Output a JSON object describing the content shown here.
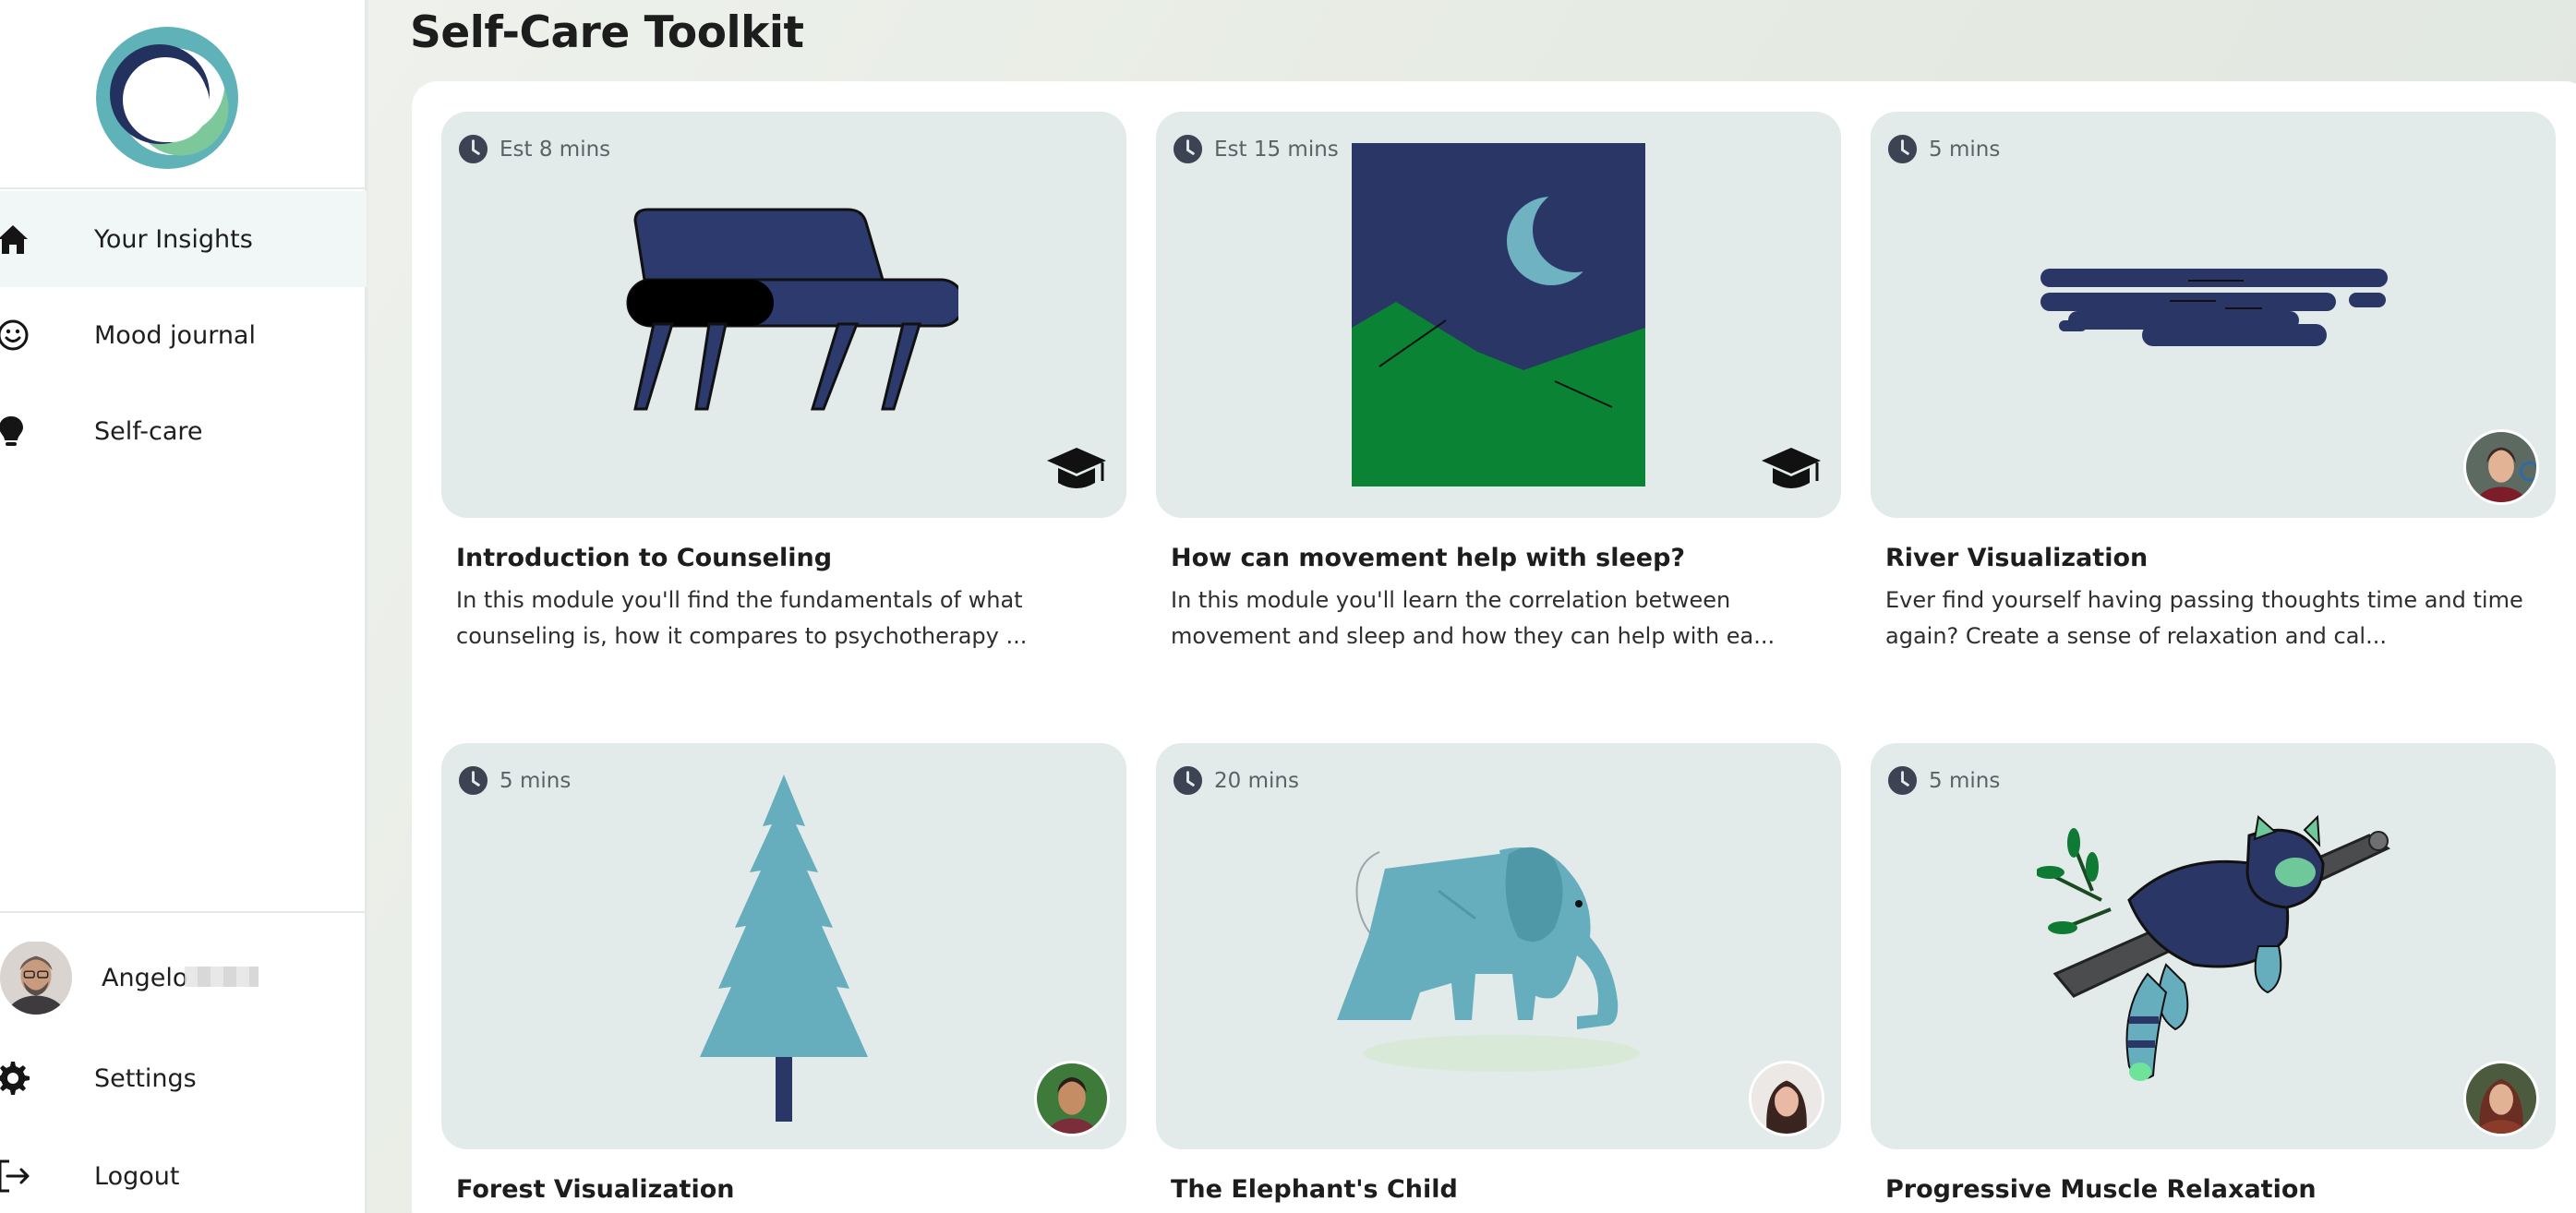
{
  "colors": {
    "accent_navy": "#2a3766",
    "accent_teal": "#66aebd",
    "accent_green": "#6fc89a",
    "card_bg": "#e2eaea",
    "active_nav_bg": "#f1f6f7"
  },
  "sidebar": {
    "logo_icon": "app-logo-ring",
    "nav": [
      {
        "label": "Your Insights",
        "icon": "home-icon",
        "active": true
      },
      {
        "label": "Mood journal",
        "icon": "smiley-icon",
        "active": false
      },
      {
        "label": "Self-care",
        "icon": "lightbulb-icon",
        "active": false
      }
    ],
    "user": {
      "name": "Angelo"
    },
    "bottom": [
      {
        "label": "Settings",
        "icon": "gear-icon"
      },
      {
        "label": "Logout",
        "icon": "logout-icon"
      }
    ]
  },
  "main": {
    "title": "Self-Care Toolkit",
    "cards": [
      {
        "duration": "Est 8 mins",
        "title": "Introduction to Counseling",
        "desc": "In this module you'll find the fundamentals of what counseling is, how it compares to psychotherapy ...",
        "art": "couch-illustration",
        "corner": "graduation-cap-icon"
      },
      {
        "duration": "Est 15 mins",
        "title": "How can movement help with sleep?",
        "desc": "In this module you'll learn the correlation between movement and sleep and how they can help with ea...",
        "art": "night-landscape-illustration",
        "corner": "graduation-cap-icon"
      },
      {
        "duration": "5 mins",
        "title": "River Visualization",
        "desc": "Ever find yourself having passing thoughts time and time again? Create a sense of relaxation and cal...",
        "art": "river-illustration",
        "corner": "author-avatar"
      },
      {
        "duration": "5 mins",
        "title": "Forest Visualization",
        "desc": "",
        "art": "pine-tree-illustration",
        "corner": "author-avatar"
      },
      {
        "duration": "20 mins",
        "title": "The Elephant's Child",
        "desc": "",
        "art": "elephant-illustration",
        "corner": "author-avatar"
      },
      {
        "duration": "5 mins",
        "title": "Progressive Muscle Relaxation",
        "desc": "",
        "art": "red-panda-illustration",
        "corner": "author-avatar"
      }
    ]
  }
}
